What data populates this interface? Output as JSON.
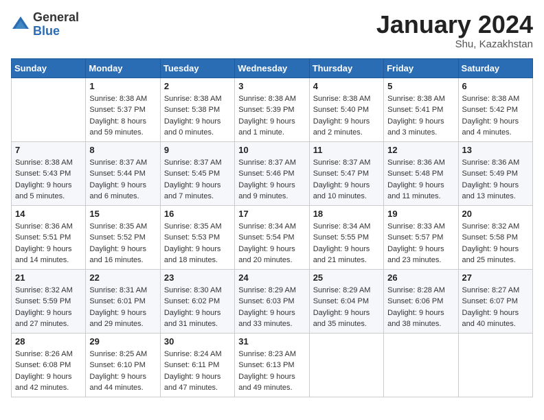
{
  "header": {
    "logo_general": "General",
    "logo_blue": "Blue",
    "month": "January 2024",
    "location": "Shu, Kazakhstan"
  },
  "weekdays": [
    "Sunday",
    "Monday",
    "Tuesday",
    "Wednesday",
    "Thursday",
    "Friday",
    "Saturday"
  ],
  "weeks": [
    [
      {
        "day": "",
        "sunrise": "",
        "sunset": "",
        "daylight": ""
      },
      {
        "day": "1",
        "sunrise": "Sunrise: 8:38 AM",
        "sunset": "Sunset: 5:37 PM",
        "daylight": "Daylight: 8 hours and 59 minutes."
      },
      {
        "day": "2",
        "sunrise": "Sunrise: 8:38 AM",
        "sunset": "Sunset: 5:38 PM",
        "daylight": "Daylight: 9 hours and 0 minutes."
      },
      {
        "day": "3",
        "sunrise": "Sunrise: 8:38 AM",
        "sunset": "Sunset: 5:39 PM",
        "daylight": "Daylight: 9 hours and 1 minute."
      },
      {
        "day": "4",
        "sunrise": "Sunrise: 8:38 AM",
        "sunset": "Sunset: 5:40 PM",
        "daylight": "Daylight: 9 hours and 2 minutes."
      },
      {
        "day": "5",
        "sunrise": "Sunrise: 8:38 AM",
        "sunset": "Sunset: 5:41 PM",
        "daylight": "Daylight: 9 hours and 3 minutes."
      },
      {
        "day": "6",
        "sunrise": "Sunrise: 8:38 AM",
        "sunset": "Sunset: 5:42 PM",
        "daylight": "Daylight: 9 hours and 4 minutes."
      }
    ],
    [
      {
        "day": "7",
        "sunrise": "Sunrise: 8:38 AM",
        "sunset": "Sunset: 5:43 PM",
        "daylight": "Daylight: 9 hours and 5 minutes."
      },
      {
        "day": "8",
        "sunrise": "Sunrise: 8:37 AM",
        "sunset": "Sunset: 5:44 PM",
        "daylight": "Daylight: 9 hours and 6 minutes."
      },
      {
        "day": "9",
        "sunrise": "Sunrise: 8:37 AM",
        "sunset": "Sunset: 5:45 PM",
        "daylight": "Daylight: 9 hours and 7 minutes."
      },
      {
        "day": "10",
        "sunrise": "Sunrise: 8:37 AM",
        "sunset": "Sunset: 5:46 PM",
        "daylight": "Daylight: 9 hours and 9 minutes."
      },
      {
        "day": "11",
        "sunrise": "Sunrise: 8:37 AM",
        "sunset": "Sunset: 5:47 PM",
        "daylight": "Daylight: 9 hours and 10 minutes."
      },
      {
        "day": "12",
        "sunrise": "Sunrise: 8:36 AM",
        "sunset": "Sunset: 5:48 PM",
        "daylight": "Daylight: 9 hours and 11 minutes."
      },
      {
        "day": "13",
        "sunrise": "Sunrise: 8:36 AM",
        "sunset": "Sunset: 5:49 PM",
        "daylight": "Daylight: 9 hours and 13 minutes."
      }
    ],
    [
      {
        "day": "14",
        "sunrise": "Sunrise: 8:36 AM",
        "sunset": "Sunset: 5:51 PM",
        "daylight": "Daylight: 9 hours and 14 minutes."
      },
      {
        "day": "15",
        "sunrise": "Sunrise: 8:35 AM",
        "sunset": "Sunset: 5:52 PM",
        "daylight": "Daylight: 9 hours and 16 minutes."
      },
      {
        "day": "16",
        "sunrise": "Sunrise: 8:35 AM",
        "sunset": "Sunset: 5:53 PM",
        "daylight": "Daylight: 9 hours and 18 minutes."
      },
      {
        "day": "17",
        "sunrise": "Sunrise: 8:34 AM",
        "sunset": "Sunset: 5:54 PM",
        "daylight": "Daylight: 9 hours and 20 minutes."
      },
      {
        "day": "18",
        "sunrise": "Sunrise: 8:34 AM",
        "sunset": "Sunset: 5:55 PM",
        "daylight": "Daylight: 9 hours and 21 minutes."
      },
      {
        "day": "19",
        "sunrise": "Sunrise: 8:33 AM",
        "sunset": "Sunset: 5:57 PM",
        "daylight": "Daylight: 9 hours and 23 minutes."
      },
      {
        "day": "20",
        "sunrise": "Sunrise: 8:32 AM",
        "sunset": "Sunset: 5:58 PM",
        "daylight": "Daylight: 9 hours and 25 minutes."
      }
    ],
    [
      {
        "day": "21",
        "sunrise": "Sunrise: 8:32 AM",
        "sunset": "Sunset: 5:59 PM",
        "daylight": "Daylight: 9 hours and 27 minutes."
      },
      {
        "day": "22",
        "sunrise": "Sunrise: 8:31 AM",
        "sunset": "Sunset: 6:01 PM",
        "daylight": "Daylight: 9 hours and 29 minutes."
      },
      {
        "day": "23",
        "sunrise": "Sunrise: 8:30 AM",
        "sunset": "Sunset: 6:02 PM",
        "daylight": "Daylight: 9 hours and 31 minutes."
      },
      {
        "day": "24",
        "sunrise": "Sunrise: 8:29 AM",
        "sunset": "Sunset: 6:03 PM",
        "daylight": "Daylight: 9 hours and 33 minutes."
      },
      {
        "day": "25",
        "sunrise": "Sunrise: 8:29 AM",
        "sunset": "Sunset: 6:04 PM",
        "daylight": "Daylight: 9 hours and 35 minutes."
      },
      {
        "day": "26",
        "sunrise": "Sunrise: 8:28 AM",
        "sunset": "Sunset: 6:06 PM",
        "daylight": "Daylight: 9 hours and 38 minutes."
      },
      {
        "day": "27",
        "sunrise": "Sunrise: 8:27 AM",
        "sunset": "Sunset: 6:07 PM",
        "daylight": "Daylight: 9 hours and 40 minutes."
      }
    ],
    [
      {
        "day": "28",
        "sunrise": "Sunrise: 8:26 AM",
        "sunset": "Sunset: 6:08 PM",
        "daylight": "Daylight: 9 hours and 42 minutes."
      },
      {
        "day": "29",
        "sunrise": "Sunrise: 8:25 AM",
        "sunset": "Sunset: 6:10 PM",
        "daylight": "Daylight: 9 hours and 44 minutes."
      },
      {
        "day": "30",
        "sunrise": "Sunrise: 8:24 AM",
        "sunset": "Sunset: 6:11 PM",
        "daylight": "Daylight: 9 hours and 47 minutes."
      },
      {
        "day": "31",
        "sunrise": "Sunrise: 8:23 AM",
        "sunset": "Sunset: 6:13 PM",
        "daylight": "Daylight: 9 hours and 49 minutes."
      },
      {
        "day": "",
        "sunrise": "",
        "sunset": "",
        "daylight": ""
      },
      {
        "day": "",
        "sunrise": "",
        "sunset": "",
        "daylight": ""
      },
      {
        "day": "",
        "sunrise": "",
        "sunset": "",
        "daylight": ""
      }
    ]
  ]
}
